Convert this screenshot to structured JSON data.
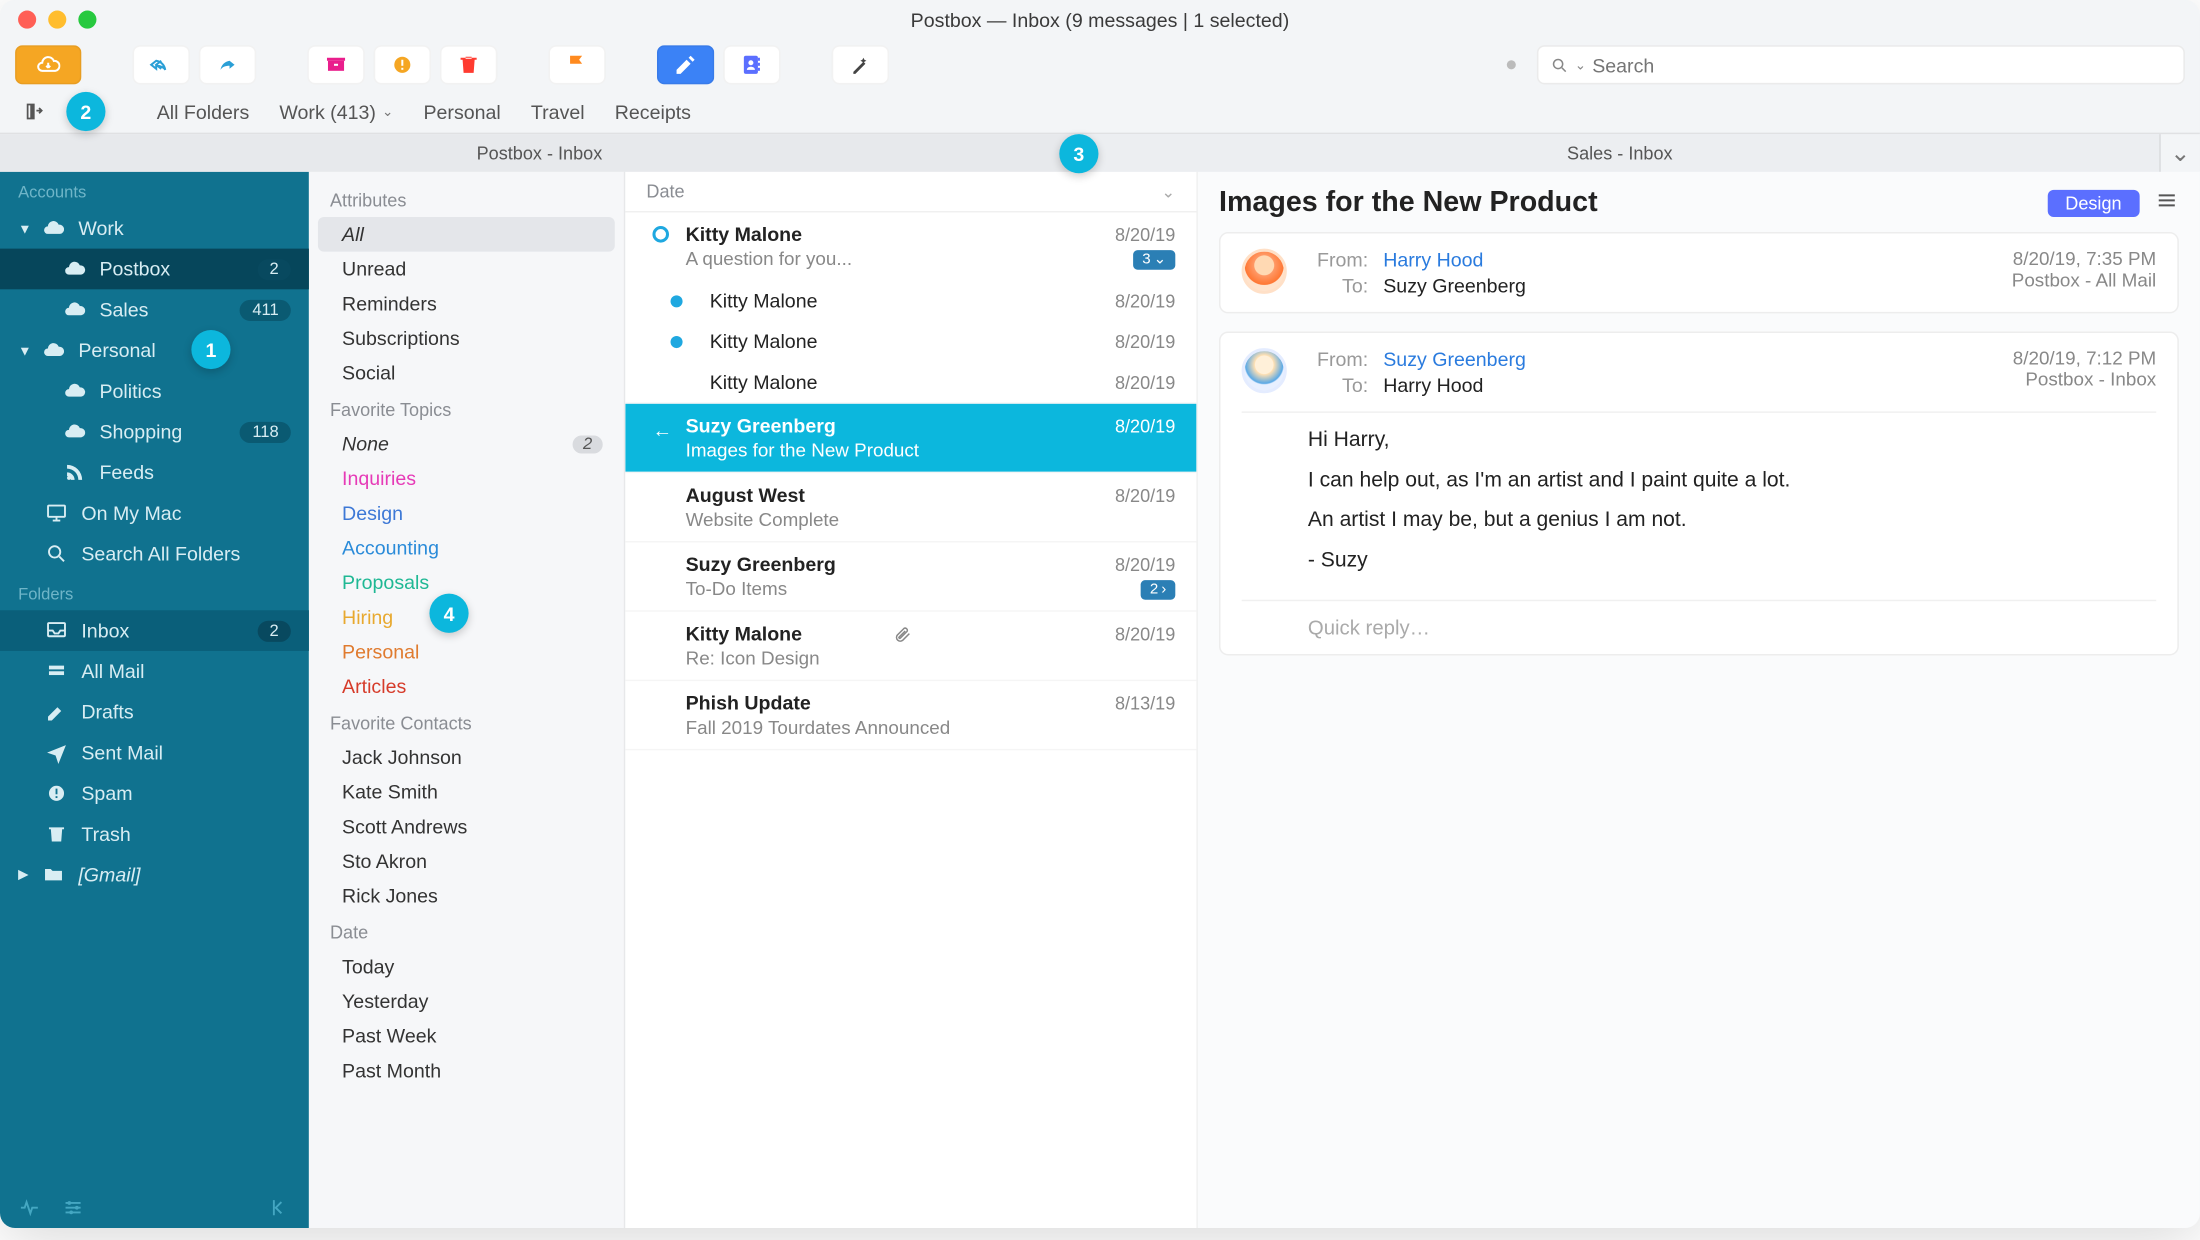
{
  "window_title": "Postbox — Inbox (9 messages | 1 selected)",
  "search": {
    "placeholder": "Search"
  },
  "favbar": {
    "items": [
      "All Folders",
      "Work (413)",
      "Personal",
      "Travel",
      "Receipts"
    ]
  },
  "tabs": {
    "left": "Postbox - Inbox",
    "right": "Sales - Inbox"
  },
  "callouts": {
    "one": "1",
    "two": "2",
    "three": "3",
    "four": "4"
  },
  "sidebar": {
    "section_accounts": "Accounts",
    "section_folders": "Folders",
    "accounts": {
      "work": {
        "label": "Work"
      },
      "postbox": {
        "label": "Postbox",
        "badge": "2"
      },
      "sales": {
        "label": "Sales",
        "badge": "411"
      },
      "personal": {
        "label": "Personal"
      },
      "politics": {
        "label": "Politics"
      },
      "shopping": {
        "label": "Shopping",
        "badge": "118"
      },
      "feeds": {
        "label": "Feeds"
      },
      "onmymac": {
        "label": "On My Mac"
      },
      "searchall": {
        "label": "Search All Folders"
      }
    },
    "folders": {
      "inbox": {
        "label": "Inbox",
        "badge": "2"
      },
      "allmail": {
        "label": "All Mail"
      },
      "drafts": {
        "label": "Drafts"
      },
      "sent": {
        "label": "Sent Mail"
      },
      "spam": {
        "label": "Spam"
      },
      "trash": {
        "label": "Trash"
      },
      "gmail": {
        "label": "[Gmail]"
      }
    }
  },
  "attrs": {
    "attributes_title": "Attributes",
    "attributes": {
      "all": "All",
      "unread": "Unread",
      "reminders": "Reminders",
      "subs": "Subscriptions",
      "social": "Social"
    },
    "topics_title": "Favorite Topics",
    "topics": {
      "none": {
        "label": "None",
        "badge": "2"
      },
      "inquiries": {
        "label": "Inquiries",
        "color": "#e63bb7"
      },
      "design": {
        "label": "Design",
        "color": "#3d78d6"
      },
      "accounting": {
        "label": "Accounting",
        "color": "#2a8bd9"
      },
      "proposals": {
        "label": "Proposals",
        "color": "#1fb894"
      },
      "hiring": {
        "label": "Hiring",
        "color": "#e8a92f"
      },
      "personal": {
        "label": "Personal",
        "color": "#e07b2f"
      },
      "articles": {
        "label": "Articles",
        "color": "#d63b2a"
      }
    },
    "contacts_title": "Favorite Contacts",
    "contacts": [
      "Jack Johnson",
      "Kate Smith",
      "Scott Andrews",
      "Sto Akron",
      "Rick Jones"
    ],
    "date_title": "Date",
    "dates": [
      "Today",
      "Yesterday",
      "Past Week",
      "Past Month"
    ]
  },
  "msglist": {
    "sort": "Date",
    "items": [
      {
        "sender": "Kitty Malone",
        "subject": "A question for you...",
        "date": "8/20/19",
        "ring": true,
        "chip": "3",
        "chip_caret": "⌄"
      },
      {
        "sender": "Kitty Malone",
        "date": "8/20/19",
        "compact": true,
        "dot": true
      },
      {
        "sender": "Kitty Malone",
        "date": "8/20/19",
        "compact": true,
        "dot": true
      },
      {
        "sender": "Kitty Malone",
        "date": "8/20/19",
        "compact": true
      },
      {
        "sender": "Suzy Greenberg",
        "subject": "Images for the New Product",
        "date": "8/20/19",
        "selected": true,
        "reply": true
      },
      {
        "sender": "August West",
        "subject": "Website Complete",
        "date": "8/20/19"
      },
      {
        "sender": "Suzy Greenberg",
        "subject": "To-Do Items",
        "date": "8/20/19",
        "chip": "2",
        "chip_caret": "›"
      },
      {
        "sender": "Kitty Malone",
        "subject": "Re: Icon Design",
        "date": "8/20/19",
        "attach": true
      },
      {
        "sender": "Phish Update",
        "subject": "Fall 2019 Tourdates Announced",
        "date": "8/13/19"
      }
    ]
  },
  "reader": {
    "title": "Images for the New Product",
    "tag": "Design",
    "labels": {
      "from": "From:",
      "to": "To:"
    },
    "card1": {
      "from": "Harry Hood",
      "to": "Suzy Greenberg",
      "date": "8/20/19, 7:35 PM",
      "folder": "Postbox - All Mail"
    },
    "card2": {
      "from": "Suzy Greenberg",
      "to": "Harry Hood",
      "date": "8/20/19, 7:12 PM",
      "folder": "Postbox - Inbox",
      "body": {
        "p1": "Hi Harry,",
        "p2": "I can help out, as I'm an artist and I paint quite a lot.",
        "p3": "An artist I may be, but a genius I am not.",
        "p4": "- Suzy"
      },
      "quick_reply": "Quick reply…"
    }
  }
}
